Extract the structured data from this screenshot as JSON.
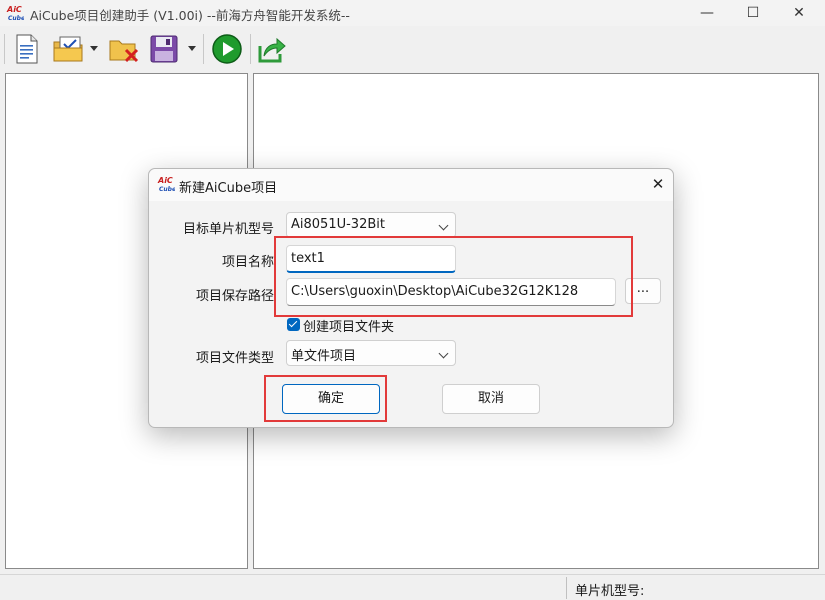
{
  "window": {
    "title": "AiCube项目创建助手 (V1.00i) --前海方舟智能开发系统--",
    "minimize": "—",
    "maximize": "☐",
    "close": "✕"
  },
  "toolbar": {
    "icons": [
      "new-document-icon",
      "open-project-icon",
      "delete-project-icon",
      "save-icon",
      "run-icon",
      "export-icon"
    ]
  },
  "statusbar": {
    "mcu_label": "单片机型号:"
  },
  "dialog": {
    "title": "新建AiCube项目",
    "close": "✕",
    "mcu_label": "目标单片机型号",
    "mcu_value": "Ai8051U-32Bit",
    "name_label": "项目名称",
    "name_value": "text1",
    "path_label": "项目保存路径",
    "path_value": "C:\\Users\\guoxin\\Desktop\\AiCube32G12K128",
    "browse": "...",
    "create_folder_label": "创建项目文件夹",
    "create_folder_checked": true,
    "type_label": "项目文件类型",
    "type_value": "单文件项目",
    "ok": "确定",
    "cancel": "取消"
  },
  "colors": {
    "accent": "#0067c0",
    "highlight": "#e23a3a"
  }
}
